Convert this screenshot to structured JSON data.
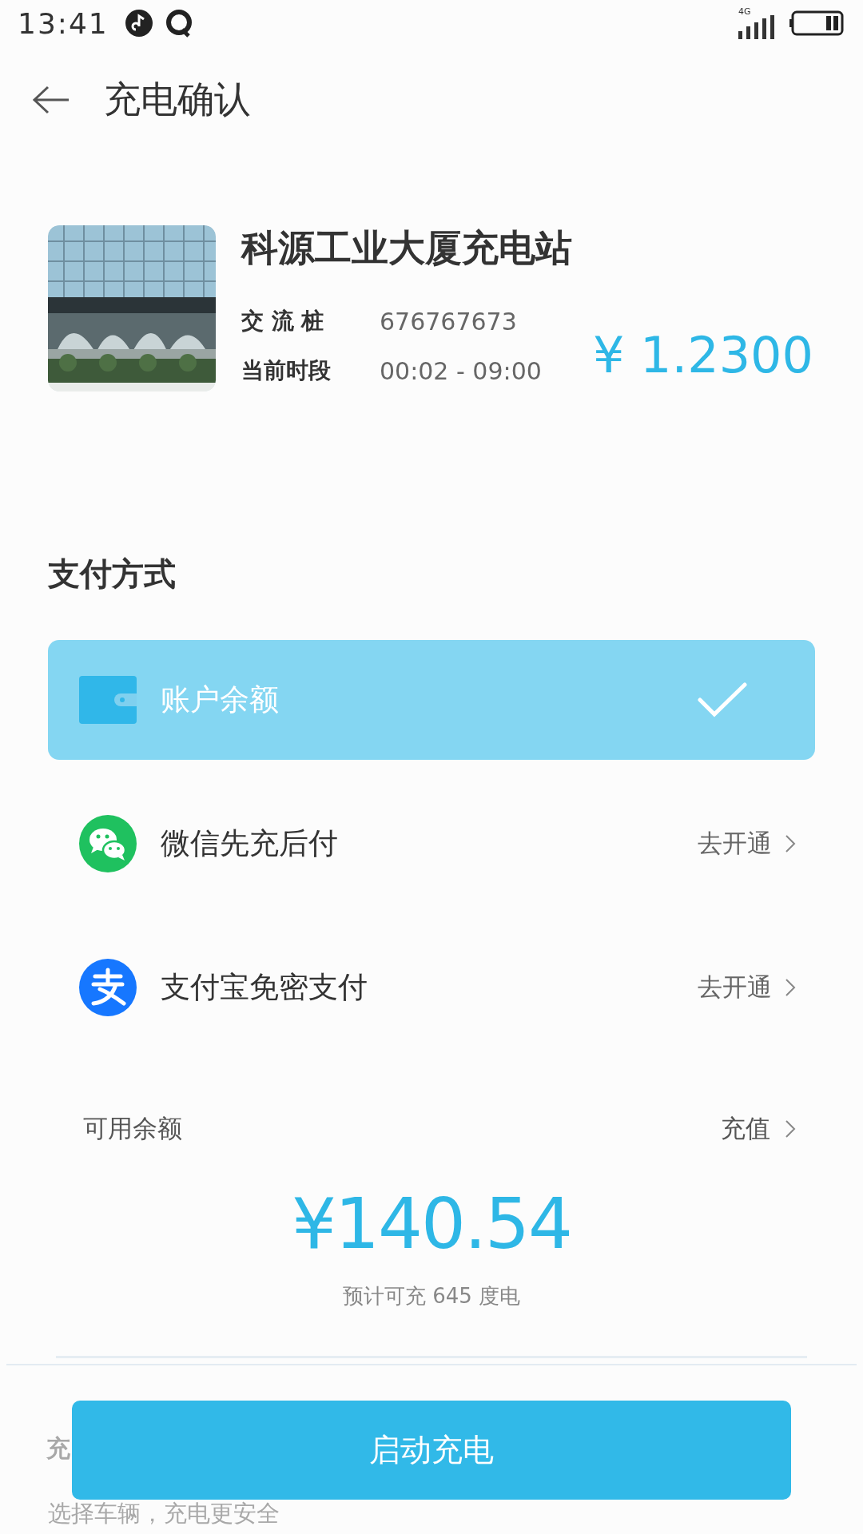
{
  "status_bar": {
    "time": "13:41",
    "network": "4G"
  },
  "header": {
    "title": "充电确认"
  },
  "station": {
    "kind": "picture",
    "name": "科源工业大厦充电站",
    "rows": [
      {
        "label": "交 流 桩",
        "value": "676767673"
      },
      {
        "label": "当前时段",
        "value": "00:02 - 09:00"
      }
    ],
    "price": "¥ 1.2300"
  },
  "payment": {
    "title": "支付方式",
    "methods": [
      {
        "kind": "wallet",
        "label": "账户余额",
        "selected": true
      },
      {
        "kind": "wechat",
        "label": "微信先充后付",
        "action": "去开通",
        "selected": false
      },
      {
        "kind": "alipay",
        "label": "支付宝免密支付",
        "action": "去开通",
        "selected": false
      }
    ]
  },
  "balance": {
    "label": "可用余额",
    "action": "充值",
    "amount": "¥140.54",
    "estimate": "预计可充 645 度电"
  },
  "vehicle": {
    "title": "充",
    "subtitle": "选择车辆，充电更安全"
  },
  "start_button": "启动充电"
}
